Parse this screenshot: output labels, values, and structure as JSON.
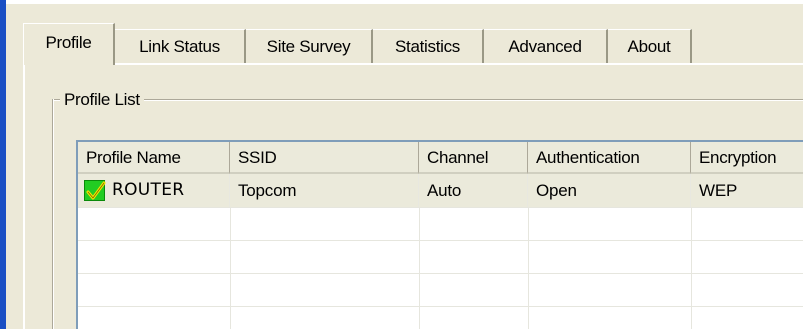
{
  "tabs": [
    {
      "label": "Profile",
      "active": true
    },
    {
      "label": "Link Status",
      "active": false
    },
    {
      "label": "Site Survey",
      "active": false
    },
    {
      "label": "Statistics",
      "active": false
    },
    {
      "label": "Advanced",
      "active": false
    },
    {
      "label": "About",
      "active": false
    }
  ],
  "profile_list": {
    "title": "Profile List",
    "columns": [
      "Profile Name",
      "SSID",
      "Channel",
      "Authentication",
      "Encryption"
    ],
    "rows": [
      {
        "active_icon": "checkmark-icon",
        "cells": [
          "ROUTER",
          "Topcom",
          "Auto",
          "Open",
          "WEP"
        ]
      }
    ]
  },
  "colors": {
    "window_bg": "#ece9d8",
    "header_bg": "#ebeadb",
    "accent_bar": "#1a4fc4",
    "check_green": "#22cc22",
    "check_mark": "#f5e600"
  }
}
